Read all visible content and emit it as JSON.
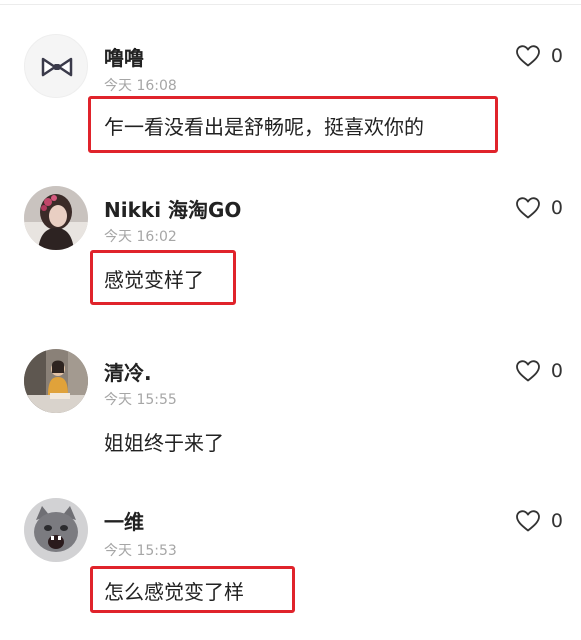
{
  "comments": [
    {
      "name": "噜噜",
      "time": "今天 16:08",
      "text": "乍一看没看出是舒畅呢，挺喜欢你的",
      "likes": "0",
      "highlighted": true,
      "avatar": "bow-tie-avatar"
    },
    {
      "name": "Nikki 海淘GO",
      "time": "今天 16:02",
      "text": "感觉变样了",
      "likes": "0",
      "highlighted": true,
      "avatar": "girl-photo-avatar"
    },
    {
      "name": "清冷.",
      "time": "今天 15:55",
      "text": "姐姐终于来了",
      "likes": "0",
      "highlighted": false,
      "avatar": "sitting-person-avatar"
    },
    {
      "name": "一维",
      "time": "今天 15:53",
      "text": "怎么感觉变了样",
      "likes": "0",
      "highlighted": true,
      "avatar": "cat-avatar"
    }
  ],
  "colors": {
    "highlight_border": "#e0232b",
    "time_text": "#a6a6a6"
  }
}
